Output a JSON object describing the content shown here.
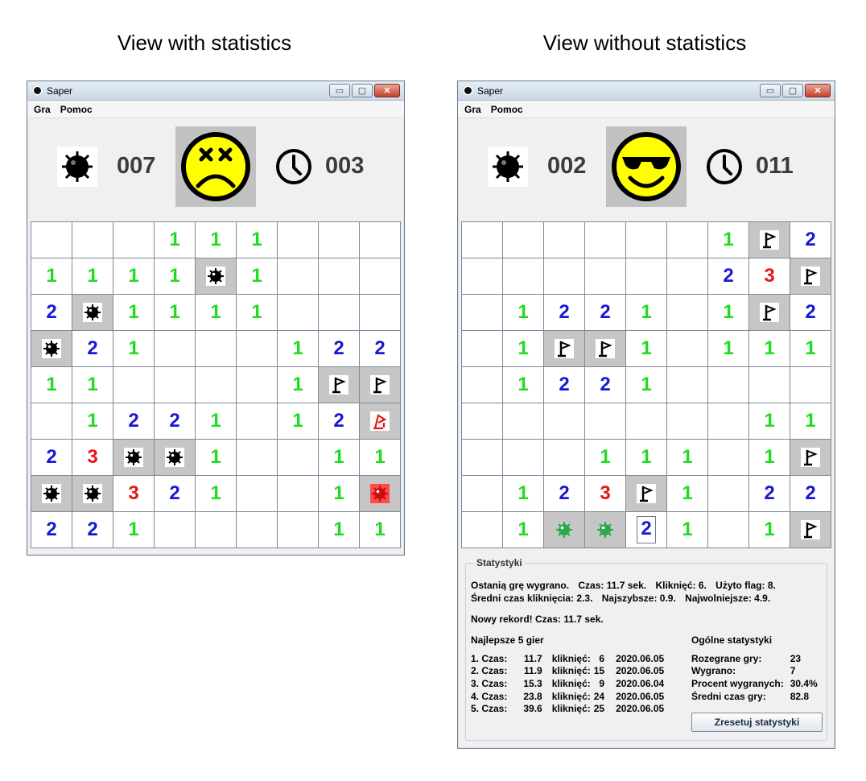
{
  "captions": {
    "left": "View with statistics",
    "right": "View without statistics"
  },
  "window": {
    "title": "Saper",
    "minimize": "▭",
    "maximize": "▢",
    "close": "✕"
  },
  "menu": [
    "Gra",
    "Pomoc"
  ],
  "colors": {
    "n1": "#1fdc1f",
    "n2": "#1818d6",
    "n3": "#e41616",
    "revealed": "#ffffff",
    "hidden": "#c6c6c6",
    "mine_exploded": "#ff4a4a",
    "mine_flagged_correct": "#2aa84a"
  },
  "left_game": {
    "mines_left": "007",
    "time": "003",
    "face": "dead",
    "board": [
      [
        " ",
        " ",
        " ",
        "1",
        "1",
        "1",
        " ",
        " ",
        " "
      ],
      [
        "1",
        "1",
        "1",
        "1",
        "M",
        "1",
        " ",
        " ",
        " "
      ],
      [
        "2",
        "M",
        "1",
        "1",
        "1",
        "1",
        " ",
        " ",
        " "
      ],
      [
        "M",
        "2",
        "1",
        " ",
        " ",
        " ",
        "1",
        "2",
        "2"
      ],
      [
        "1",
        "1",
        " ",
        " ",
        " ",
        " ",
        "1",
        "F",
        "F"
      ],
      [
        " ",
        "1",
        "2",
        "2",
        "1",
        " ",
        "1",
        "2",
        "WF"
      ],
      [
        "2",
        "3",
        "M",
        "M",
        "1",
        " ",
        " ",
        "1",
        "1"
      ],
      [
        "M",
        "M",
        "3",
        "2",
        "1",
        " ",
        " ",
        "1",
        "X"
      ],
      [
        "2",
        "2",
        "1",
        " ",
        " ",
        " ",
        " ",
        "1",
        "1"
      ]
    ]
  },
  "right_game": {
    "mines_left": "002",
    "time": "011",
    "face": "cool",
    "board": [
      [
        " ",
        " ",
        " ",
        " ",
        " ",
        " ",
        "1",
        "F",
        "2"
      ],
      [
        " ",
        " ",
        " ",
        " ",
        " ",
        " ",
        "2",
        "3",
        "F"
      ],
      [
        " ",
        "1",
        "2",
        "2",
        "1",
        " ",
        "1",
        "F",
        "2"
      ],
      [
        " ",
        "1",
        "F",
        "F",
        "1",
        " ",
        "1",
        "1",
        "1"
      ],
      [
        " ",
        "1",
        "2",
        "2",
        "1",
        " ",
        " ",
        " ",
        " "
      ],
      [
        " ",
        " ",
        " ",
        " ",
        " ",
        " ",
        " ",
        "1",
        "1"
      ],
      [
        " ",
        " ",
        " ",
        "1",
        "1",
        "1",
        " ",
        "1",
        "F"
      ],
      [
        " ",
        "1",
        "2",
        "3",
        "F",
        "1",
        " ",
        "2",
        "2"
      ],
      [
        " ",
        "1",
        "G",
        "G",
        "2b",
        "1",
        " ",
        "1",
        "F"
      ]
    ]
  },
  "stats": {
    "legend": "Statystyki",
    "line1": [
      "Ostanią grę wygrano.",
      "Czas:  11.7 sek.",
      "Kliknięć:  6.",
      "Użyto flag:  8."
    ],
    "line2": [
      "Średni czas kliknięcia:  2.3.",
      "Najszybsze:  0.9.",
      "Najwolniejsze:  4.9."
    ],
    "record": "Nowy rekord!  Czas:  11.7 sek.",
    "best_title": "Najlepsze 5 gier",
    "best": [
      [
        "1. Czas:",
        "11.7",
        "kliknięć:",
        "6",
        "2020.06.05"
      ],
      [
        "2. Czas:",
        "11.9",
        "kliknięć:",
        "15",
        "2020.06.05"
      ],
      [
        "3. Czas:",
        "15.3",
        "kliknięć:",
        "9",
        "2020.06.04"
      ],
      [
        "4. Czas:",
        "23.8",
        "kliknięć:",
        "24",
        "2020.06.05"
      ],
      [
        "5. Czas:",
        "39.6",
        "kliknięć:",
        "25",
        "2020.06.05"
      ]
    ],
    "general_title": "Ogólne statystyki",
    "general": [
      [
        "Rozegrane gry:",
        "23"
      ],
      [
        "Wygrano:",
        "7"
      ],
      [
        "Procent wygranych:",
        "30.4%"
      ],
      [
        "Średni czas gry:",
        "82.8"
      ]
    ],
    "reset": "Zresetuj statystyki"
  }
}
